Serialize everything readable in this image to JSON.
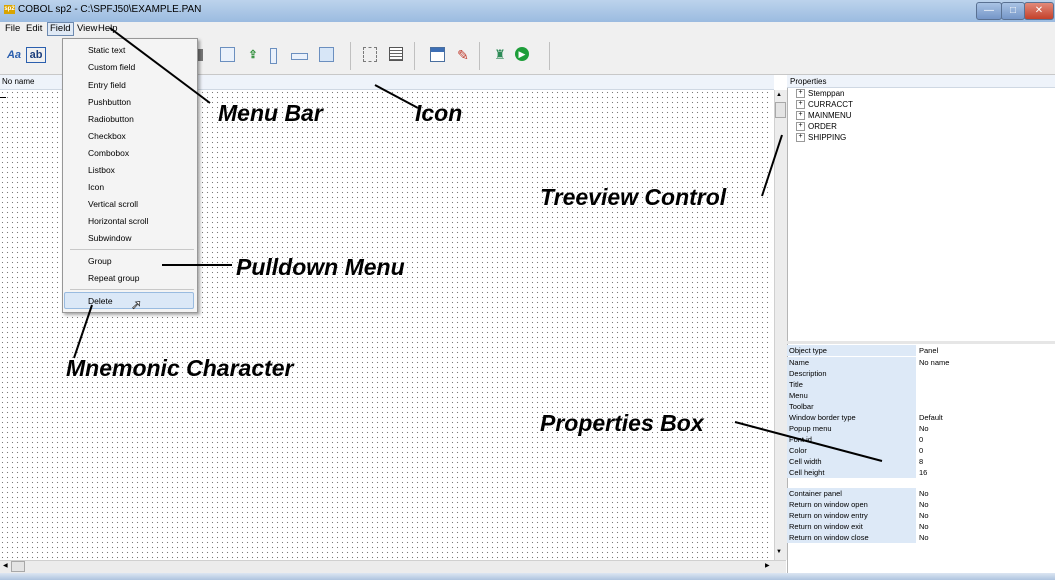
{
  "window": {
    "title": "COBOL sp2 - C:\\SPFJ50\\EXAMPLE.PAN",
    "app_icon_text": "sp2",
    "min_glyph": "—",
    "max_glyph": "□",
    "close_glyph": "✕"
  },
  "menubar": {
    "file": "File",
    "edit": "Edit",
    "field": "Field",
    "view": "View",
    "help": "Help"
  },
  "toolbar": {
    "static_text_glyph": "Aa",
    "entry_field_glyph": "ab"
  },
  "canvas": {
    "label": "No name"
  },
  "field_menu": {
    "items": [
      "Static text",
      "Custom field",
      "Entry field",
      "Pushbutton",
      "Radiobutton",
      "Checkbox",
      "Combobox",
      "Listbox",
      "Icon",
      "Vertical scroll",
      "Horizontal scroll",
      "Subwindow",
      "Group",
      "Repeat group",
      "Delete"
    ]
  },
  "properties": {
    "header": "Properties",
    "tree": [
      "Stemppan",
      "CURRACCT",
      "MAINMENU",
      "ORDER",
      "SHIPPING"
    ],
    "tree_expander": "+",
    "rows": [
      {
        "name": "Object type",
        "value": "Panel"
      },
      {
        "name": "Name",
        "value": "No name"
      },
      {
        "name": "Description",
        "value": ""
      },
      {
        "name": "Title",
        "value": ""
      },
      {
        "name": "Menu",
        "value": ""
      },
      {
        "name": "Toolbar",
        "value": ""
      },
      {
        "name": "Window border type",
        "value": "Default"
      },
      {
        "name": "Popup menu",
        "value": "No"
      },
      {
        "name": "Font id",
        "value": "0"
      },
      {
        "name": "Color",
        "value": "0"
      },
      {
        "name": "Cell width",
        "value": "8"
      },
      {
        "name": "Cell height",
        "value": "16"
      },
      {
        "name": "Container panel",
        "value": "No"
      },
      {
        "name": "Return on window open",
        "value": "No"
      },
      {
        "name": "Return on window entry",
        "value": "No"
      },
      {
        "name": "Return on window exit",
        "value": "No"
      },
      {
        "name": "Return on window close",
        "value": "No"
      }
    ]
  },
  "callouts": {
    "menu_bar": "Menu Bar",
    "icon": "Icon",
    "treeview": "Treeview Control",
    "pulldown": "Pulldown Menu",
    "mnemonic": "Mnemonic Character",
    "properties_box": "Properties Box"
  },
  "colors": {
    "title_bar": "#bcd3ec",
    "property_name_bg": "#dde9f7",
    "menu_highlight": "#dbe8f7",
    "close_button": "#c4412b"
  }
}
